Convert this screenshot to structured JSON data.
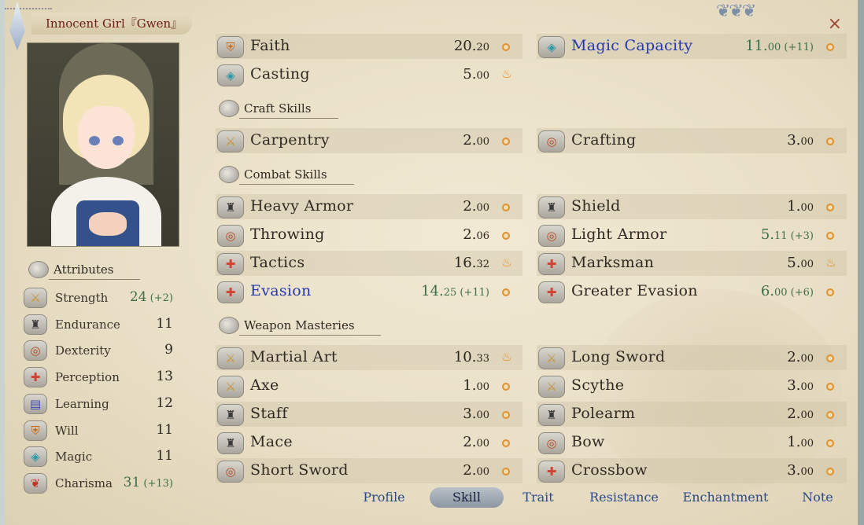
{
  "window": {
    "title": "Innocent Girl『Gwen』",
    "close_symbol": "×",
    "ornament": "❦❦❦"
  },
  "attributes": {
    "header": "Attributes",
    "items": [
      {
        "label": "Strength",
        "value": "24",
        "bonus": "(+2)",
        "icon": "sword-icon",
        "glyph": "⚔"
      },
      {
        "label": "Endurance",
        "value": "11",
        "bonus": "",
        "icon": "helm-icon",
        "glyph": "♜"
      },
      {
        "label": "Dexterity",
        "value": "9",
        "bonus": "",
        "icon": "ring-icon",
        "glyph": "◎"
      },
      {
        "label": "Perception",
        "value": "13",
        "bonus": "",
        "icon": "cross-icon",
        "glyph": "✚"
      },
      {
        "label": "Learning",
        "value": "12",
        "bonus": "",
        "icon": "book-icon",
        "glyph": "▤"
      },
      {
        "label": "Will",
        "value": "11",
        "bonus": "",
        "icon": "shield-icon",
        "glyph": "⛨"
      },
      {
        "label": "Magic",
        "value": "11",
        "bonus": "",
        "icon": "diamond-icon",
        "glyph": "◈"
      },
      {
        "label": "Charisma",
        "value": "31",
        "bonus": "(+13)",
        "icon": "bow-icon",
        "glyph": "❦"
      }
    ]
  },
  "skills": {
    "top": [
      {
        "label": "Faith",
        "value": "20.",
        "decimal": "20",
        "bonus": "",
        "potential": "dot",
        "icon": "shield-icon",
        "glyph": "⛨"
      },
      {
        "label": "Magic Capacity",
        "value": "11.",
        "decimal": "00",
        "bonus": "(+11)",
        "potential": "dot",
        "icon": "diamond-icon",
        "glyph": "◈",
        "highlight": true
      },
      {
        "label": "Casting",
        "value": "5.",
        "decimal": "00",
        "bonus": "",
        "potential": "flame",
        "icon": "diamond-icon",
        "glyph": "◈"
      }
    ],
    "craft_header": "Craft Skills",
    "craft": [
      {
        "label": "Carpentry",
        "value": "2.",
        "decimal": "00",
        "bonus": "",
        "potential": "dot",
        "icon": "sword-icon",
        "glyph": "⚔"
      },
      {
        "label": "Crafting",
        "value": "3.",
        "decimal": "00",
        "bonus": "",
        "potential": "dot",
        "icon": "ring-icon",
        "glyph": "◎"
      }
    ],
    "combat_header": "Combat Skills",
    "combat": [
      {
        "label": "Heavy Armor",
        "value": "2.",
        "decimal": "00",
        "bonus": "",
        "potential": "dot",
        "icon": "helm-icon",
        "glyph": "♜"
      },
      {
        "label": "Shield",
        "value": "1.",
        "decimal": "00",
        "bonus": "",
        "potential": "dot",
        "icon": "helm-icon",
        "glyph": "♜"
      },
      {
        "label": "Throwing",
        "value": "2.",
        "decimal": "06",
        "bonus": "",
        "potential": "dot",
        "icon": "ring-icon",
        "glyph": "◎"
      },
      {
        "label": "Light Armor",
        "value": "5.",
        "decimal": "11",
        "bonus": "(+3)",
        "potential": "dot",
        "icon": "ring-icon",
        "glyph": "◎"
      },
      {
        "label": "Tactics",
        "value": "16.",
        "decimal": "32",
        "bonus": "",
        "potential": "flame",
        "icon": "cross-icon",
        "glyph": "✚"
      },
      {
        "label": "Marksman",
        "value": "5.",
        "decimal": "00",
        "bonus": "",
        "potential": "flame",
        "icon": "cross-icon",
        "glyph": "✚"
      },
      {
        "label": "Evasion",
        "value": "14.",
        "decimal": "25",
        "bonus": "(+11)",
        "potential": "dot",
        "icon": "cross-icon",
        "glyph": "✚",
        "highlight": true
      },
      {
        "label": "Greater Evasion",
        "value": "6.",
        "decimal": "00",
        "bonus": "(+6)",
        "potential": "dot",
        "icon": "cross-icon",
        "glyph": "✚"
      }
    ],
    "weapon_header": "Weapon Masteries",
    "weapon": [
      {
        "label": "Martial Art",
        "value": "10.",
        "decimal": "33",
        "bonus": "",
        "potential": "flame",
        "icon": "sword-icon",
        "glyph": "⚔"
      },
      {
        "label": "Long Sword",
        "value": "2.",
        "decimal": "00",
        "bonus": "",
        "potential": "dot",
        "icon": "sword-icon",
        "glyph": "⚔"
      },
      {
        "label": "Axe",
        "value": "1.",
        "decimal": "00",
        "bonus": "",
        "potential": "dot",
        "icon": "sword-icon",
        "glyph": "⚔"
      },
      {
        "label": "Scythe",
        "value": "3.",
        "decimal": "00",
        "bonus": "",
        "potential": "dot",
        "icon": "sword-icon",
        "glyph": "⚔"
      },
      {
        "label": "Staff",
        "value": "3.",
        "decimal": "00",
        "bonus": "",
        "potential": "dot",
        "icon": "helm-icon",
        "glyph": "♜"
      },
      {
        "label": "Polearm",
        "value": "2.",
        "decimal": "00",
        "bonus": "",
        "potential": "dot",
        "icon": "helm-icon",
        "glyph": "♜"
      },
      {
        "label": "Mace",
        "value": "2.",
        "decimal": "00",
        "bonus": "",
        "potential": "dot",
        "icon": "helm-icon",
        "glyph": "♜"
      },
      {
        "label": "Bow",
        "value": "1.",
        "decimal": "00",
        "bonus": "",
        "potential": "dot",
        "icon": "ring-icon",
        "glyph": "◎"
      },
      {
        "label": "Short Sword",
        "value": "2.",
        "decimal": "00",
        "bonus": "",
        "potential": "dot",
        "icon": "ring-icon",
        "glyph": "◎"
      },
      {
        "label": "Crossbow",
        "value": "3.",
        "decimal": "00",
        "bonus": "",
        "potential": "dot",
        "icon": "cross-icon",
        "glyph": "✚"
      }
    ]
  },
  "tabs": [
    {
      "label": "Profile",
      "active": false
    },
    {
      "label": "Skill",
      "active": true
    },
    {
      "label": "Trait",
      "active": false
    },
    {
      "label": "Resistance",
      "active": false
    },
    {
      "label": "Enchantment",
      "active": false
    },
    {
      "label": "Note",
      "active": false
    }
  ],
  "colors": {
    "highlight": "#2436b0",
    "bonus_green": "#3e6d49",
    "potential_flame": "#e68a1c",
    "tab_text": "#2b4a88"
  }
}
